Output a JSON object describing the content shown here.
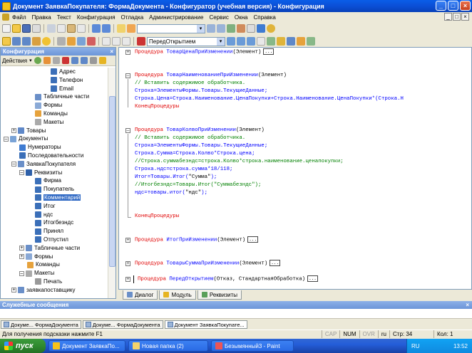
{
  "window": {
    "title": "Документ ЗаявкаПокупателя: ФормаДокумента - Конфигуратор (учебная версия) - Конфигурация",
    "minimize": "_",
    "maximize": "□",
    "close": "×"
  },
  "menu": [
    "Файл",
    "Правка",
    "Текст",
    "Конфигурация",
    "Отладка",
    "Администрирование",
    "Сервис",
    "Окна",
    "Справка"
  ],
  "toolbar": {
    "search_value": "",
    "procedure_combo": "ПередОткрытием"
  },
  "config_panel": {
    "title": "Конфигурация",
    "close": "×",
    "actions_label": "Действия",
    "tree": [
      {
        "label": "Адрес",
        "indent": 5,
        "icon": "attribute",
        "exp": ""
      },
      {
        "label": "Телефон",
        "indent": 5,
        "icon": "attribute",
        "exp": ""
      },
      {
        "label": "Email",
        "indent": 5,
        "icon": "attribute",
        "exp": ""
      },
      {
        "label": "Табличные части",
        "indent": 3,
        "icon": "table",
        "exp": ""
      },
      {
        "label": "Формы",
        "indent": 3,
        "icon": "form",
        "exp": ""
      },
      {
        "label": "Команды",
        "indent": 3,
        "icon": "command",
        "exp": ""
      },
      {
        "label": "Макеты",
        "indent": 3,
        "icon": "template",
        "exp": ""
      },
      {
        "label": "Товары",
        "indent": 1,
        "icon": "catalog",
        "exp": "+"
      },
      {
        "label": "Документы",
        "indent": 0,
        "icon": "documents",
        "exp": "-"
      },
      {
        "label": "Нумераторы",
        "indent": 1,
        "icon": "numerator",
        "exp": ""
      },
      {
        "label": "Последовательности",
        "indent": 1,
        "icon": "sequence",
        "exp": ""
      },
      {
        "label": "ЗаявкаПокупателя",
        "indent": 1,
        "icon": "document",
        "exp": "-"
      },
      {
        "label": "Реквизиты",
        "indent": 2,
        "icon": "attributes",
        "exp": "-"
      },
      {
        "label": "Фирма",
        "indent": 3,
        "icon": "attribute",
        "exp": ""
      },
      {
        "label": "Покупатель",
        "indent": 3,
        "icon": "attribute",
        "exp": ""
      },
      {
        "label": "Комментарий",
        "indent": 3,
        "icon": "attribute",
        "exp": "",
        "selected": true
      },
      {
        "label": "Итог",
        "indent": 3,
        "icon": "attribute",
        "exp": ""
      },
      {
        "label": "ндс",
        "indent": 3,
        "icon": "attribute",
        "exp": ""
      },
      {
        "label": "Итогбезндс",
        "indent": 3,
        "icon": "attribute",
        "exp": ""
      },
      {
        "label": "Принял",
        "indent": 3,
        "icon": "attribute",
        "exp": ""
      },
      {
        "label": "Отпустил",
        "indent": 3,
        "icon": "attribute",
        "exp": ""
      },
      {
        "label": "Табличные части",
        "indent": 2,
        "icon": "table",
        "exp": "+"
      },
      {
        "label": "Формы",
        "indent": 2,
        "icon": "form",
        "exp": "+"
      },
      {
        "label": "Команды",
        "indent": 2,
        "icon": "command",
        "exp": ""
      },
      {
        "label": "Макеты",
        "indent": 2,
        "icon": "template",
        "exp": "-"
      },
      {
        "label": "Печать",
        "indent": 3,
        "icon": "print",
        "exp": ""
      },
      {
        "label": "заявкапоставщику",
        "indent": 1,
        "icon": "document",
        "exp": "+"
      }
    ]
  },
  "code": [
    {
      "segs": [
        [
          "kw",
          "Процедура "
        ],
        [
          "id",
          "ТоварЦенаПриИзменении"
        ],
        [
          "ps",
          "(Элемент)"
        ]
      ],
      "fold": "+",
      "dots": true
    },
    {
      "segs": []
    },
    {
      "segs": []
    },
    {
      "segs": [
        [
          "kw",
          "Процедура "
        ],
        [
          "id",
          "ТоварНаименованиеПриИзменении"
        ],
        [
          "ps",
          "(Элемент)"
        ]
      ],
      "fold": "-"
    },
    {
      "segs": [
        [
          "cm",
          "    // Вставить содержимое обработчика."
        ]
      ]
    },
    {
      "segs": [
        [
          "id",
          "    Строка=ЭлементыФормы.Товары.ТекущиеДанные;"
        ]
      ]
    },
    {
      "segs": [
        [
          "id",
          "    Строка.Цена=Строка.Наименование.ЦенаПокупки+Строка.Наименование.ЦенаПокупки*(Строка.Н"
        ]
      ]
    },
    {
      "segs": [
        [
          "kw",
          "КонецПроцедуры"
        ]
      ]
    },
    {
      "segs": []
    },
    {
      "segs": []
    },
    {
      "segs": [
        [
          "kw",
          "Процедура "
        ],
        [
          "id",
          "ТоварКолвоПриИзменении"
        ],
        [
          "ps",
          "(Элемент)"
        ]
      ],
      "fold": "-"
    },
    {
      "segs": [
        [
          "cm",
          "    // Вставить содержимое обработчика."
        ]
      ]
    },
    {
      "segs": [
        [
          "id",
          "    Строка=ЭлементыФормы.Товары.ТекущиеДанные;"
        ]
      ]
    },
    {
      "segs": [
        [
          "id",
          "    Строка.Сумма=Строка.Колво*Строка.цена;"
        ]
      ]
    },
    {
      "segs": [
        [
          "cm",
          "    //Строка.суммабезндс=строка.Колво*строка.наименование.ценапокупки;"
        ]
      ]
    },
    {
      "segs": [
        [
          "id",
          "    Строка.ндс=строка.сумма*18/118;"
        ]
      ]
    },
    {
      "segs": [
        [
          "id",
          "    Итог=Товары.Итог("
        ],
        [
          "ps",
          "\"Сумма\""
        ],
        [
          "id",
          ");"
        ]
      ]
    },
    {
      "segs": [
        [
          "cm",
          "    //Итогбезндс=Товары.Итог(\"Суммабезндс\");"
        ]
      ]
    },
    {
      "segs": [
        [
          "id",
          "    ндс=товары.итог("
        ],
        [
          "ps",
          "\"ндс\""
        ],
        [
          "id",
          ");"
        ]
      ]
    },
    {
      "segs": []
    },
    {
      "segs": []
    },
    {
      "segs": [
        [
          "kw",
          "КонецПроцедуры"
        ]
      ],
      "foldend": true
    },
    {
      "segs": []
    },
    {
      "segs": []
    },
    {
      "segs": [
        [
          "kw",
          "Процедура "
        ],
        [
          "id",
          "ИтогПриИзменении"
        ],
        [
          "ps",
          "(Элемент)"
        ]
      ],
      "fold": "+",
      "dots": true
    },
    {
      "segs": []
    },
    {
      "segs": []
    },
    {
      "segs": [
        [
          "kw",
          "Процедура "
        ],
        [
          "id",
          "ТоварыСуммаПриИзменении"
        ],
        [
          "ps",
          "(Элемент)"
        ]
      ],
      "fold": "+",
      "dots": true
    },
    {
      "segs": []
    },
    {
      "segs": [
        [
          "kw",
          "Процедура "
        ],
        [
          "id",
          "ПередОткрытием"
        ],
        [
          "ps",
          "(Отказ, СтандартнаяОбработка)"
        ]
      ],
      "fold": "+",
      "dots": true,
      "cursor": true
    }
  ],
  "editor_tabs": [
    {
      "label": "Диалог",
      "icon": "#6a8fc8"
    },
    {
      "label": "Модуль",
      "icon": "#e6b422"
    },
    {
      "label": "Реквизиты",
      "icon": "#5aa05a"
    }
  ],
  "service_messages": {
    "title": "Служебные сообщения",
    "close": "×"
  },
  "window_tabs": [
    {
      "label": "Докуме... ФормаДокумента",
      "active": false
    },
    {
      "label": "Докуме... ФормаДокумента",
      "active": false
    },
    {
      "label": "Документ ЗаявкаПокупате...",
      "active": true
    }
  ],
  "status": {
    "hint": "Для получения подсказки нажмите F1",
    "cap": "CAP",
    "num": "NUM",
    "ovr": "OVR",
    "lang": "ru",
    "line": "Стр: 34",
    "col": "Кол: 1"
  },
  "taskbar": {
    "start": "пуск",
    "buttons": [
      {
        "label": "Документ ЗаявкаПо...",
        "icon": "#f6c21a"
      },
      {
        "label": "Новая папка (2)",
        "icon": "#f3d36b"
      },
      {
        "label": "Безымянный3 - Paint",
        "icon": "#e55"
      }
    ],
    "lang": "RU",
    "time": "13:52"
  }
}
